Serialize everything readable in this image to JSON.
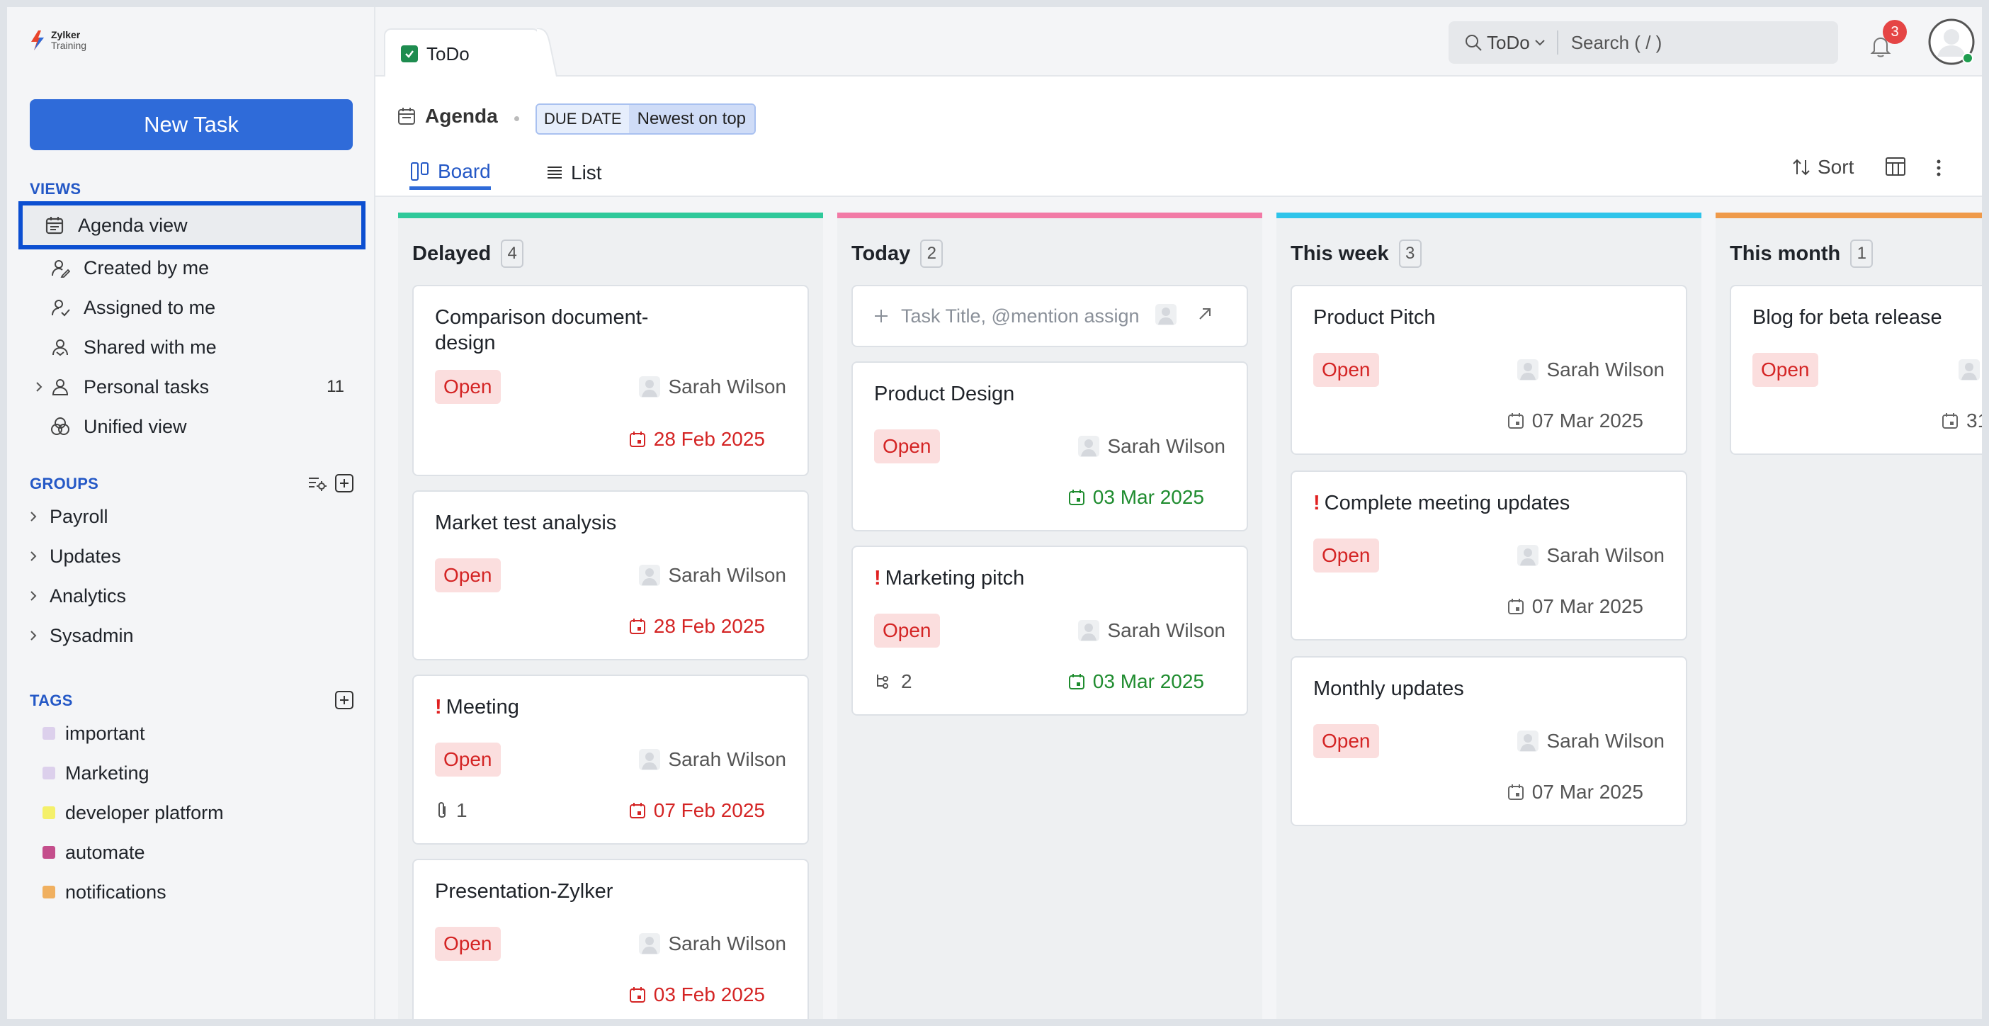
{
  "logo": {
    "name": "Zylker",
    "sub": "Training"
  },
  "sidebar": {
    "new_task_label": "New Task",
    "views_title": "VIEWS",
    "views": [
      {
        "label": "Agenda view",
        "icon": "calendar-icon",
        "active": true
      },
      {
        "label": "Created by me",
        "icon": "user-pen-icon"
      },
      {
        "label": "Assigned to me",
        "icon": "user-assign-icon"
      },
      {
        "label": "Shared with me",
        "icon": "user-share-icon"
      },
      {
        "label": "Personal tasks",
        "icon": "user-icon",
        "count": "11",
        "expandable": true
      },
      {
        "label": "Unified view",
        "icon": "unified-icon"
      }
    ],
    "groups_title": "GROUPS",
    "groups": [
      "Payroll",
      "Updates",
      "Analytics",
      "Sysadmin"
    ],
    "tags_title": "TAGS",
    "tags": [
      {
        "label": "important",
        "color": "#dcd0ec"
      },
      {
        "label": "Marketing",
        "color": "#dcd0ec"
      },
      {
        "label": "developer platform",
        "color": "#f4f06a"
      },
      {
        "label": "automate",
        "color": "#c44e8c"
      },
      {
        "label": "notifications",
        "color": "#f0b060"
      }
    ]
  },
  "topbar": {
    "tab_label": "ToDo",
    "search_scope": "ToDo",
    "search_placeholder": "Search ( / )",
    "notification_count": "3"
  },
  "subbar": {
    "title": "Agenda",
    "filter_key": "DUE DATE",
    "filter_value": "Newest on top",
    "tabs": [
      "Board",
      "List"
    ],
    "sort_label": "Sort"
  },
  "board": {
    "quick_add_placeholder": "Task Title, @mention assign",
    "columns": [
      {
        "title": "Delayed",
        "count": "4",
        "color": "#2ec99a",
        "cards": [
          {
            "title": "Comparison document-design",
            "status": "Open",
            "assignee": "Sarah Wilson",
            "due": "28 Feb 2025"
          },
          {
            "title": "Market test analysis",
            "status": "Open",
            "assignee": "Sarah Wilson",
            "due": "28 Feb 2025"
          },
          {
            "title": "Meeting",
            "important": true,
            "status": "Open",
            "assignee": "Sarah Wilson",
            "due": "07 Feb 2025",
            "attachments": "1"
          },
          {
            "title": "Presentation-Zylker",
            "status": "Open",
            "assignee": "Sarah Wilson",
            "due": "03 Feb 2025"
          }
        ]
      },
      {
        "title": "Today",
        "count": "2",
        "color": "#f27aa6",
        "cards": [
          {
            "title": "Product Design",
            "status": "Open",
            "assignee": "Sarah Wilson",
            "due": "03 Mar 2025"
          },
          {
            "title": "Marketing pitch",
            "important": true,
            "status": "Open",
            "assignee": "Sarah Wilson",
            "due": "03 Mar 2025",
            "subtasks": "2"
          }
        ]
      },
      {
        "title": "This week",
        "count": "3",
        "color": "#2ec4ea",
        "cards": [
          {
            "title": "Product Pitch",
            "status": "Open",
            "assignee": "Sarah Wilson",
            "due": "07 Mar 2025"
          },
          {
            "title": "Complete meeting updates",
            "important": true,
            "status": "Open",
            "assignee": "Sarah Wilson",
            "due": "07 Mar 2025"
          },
          {
            "title": "Monthly updates",
            "status": "Open",
            "assignee": "Sarah Wilson",
            "due": "07 Mar 2025"
          }
        ]
      },
      {
        "title": "This month",
        "count": "1",
        "color": "#ef9a4a",
        "cards": [
          {
            "title": "Blog for beta release",
            "status": "Open",
            "due": "31"
          }
        ]
      }
    ]
  }
}
